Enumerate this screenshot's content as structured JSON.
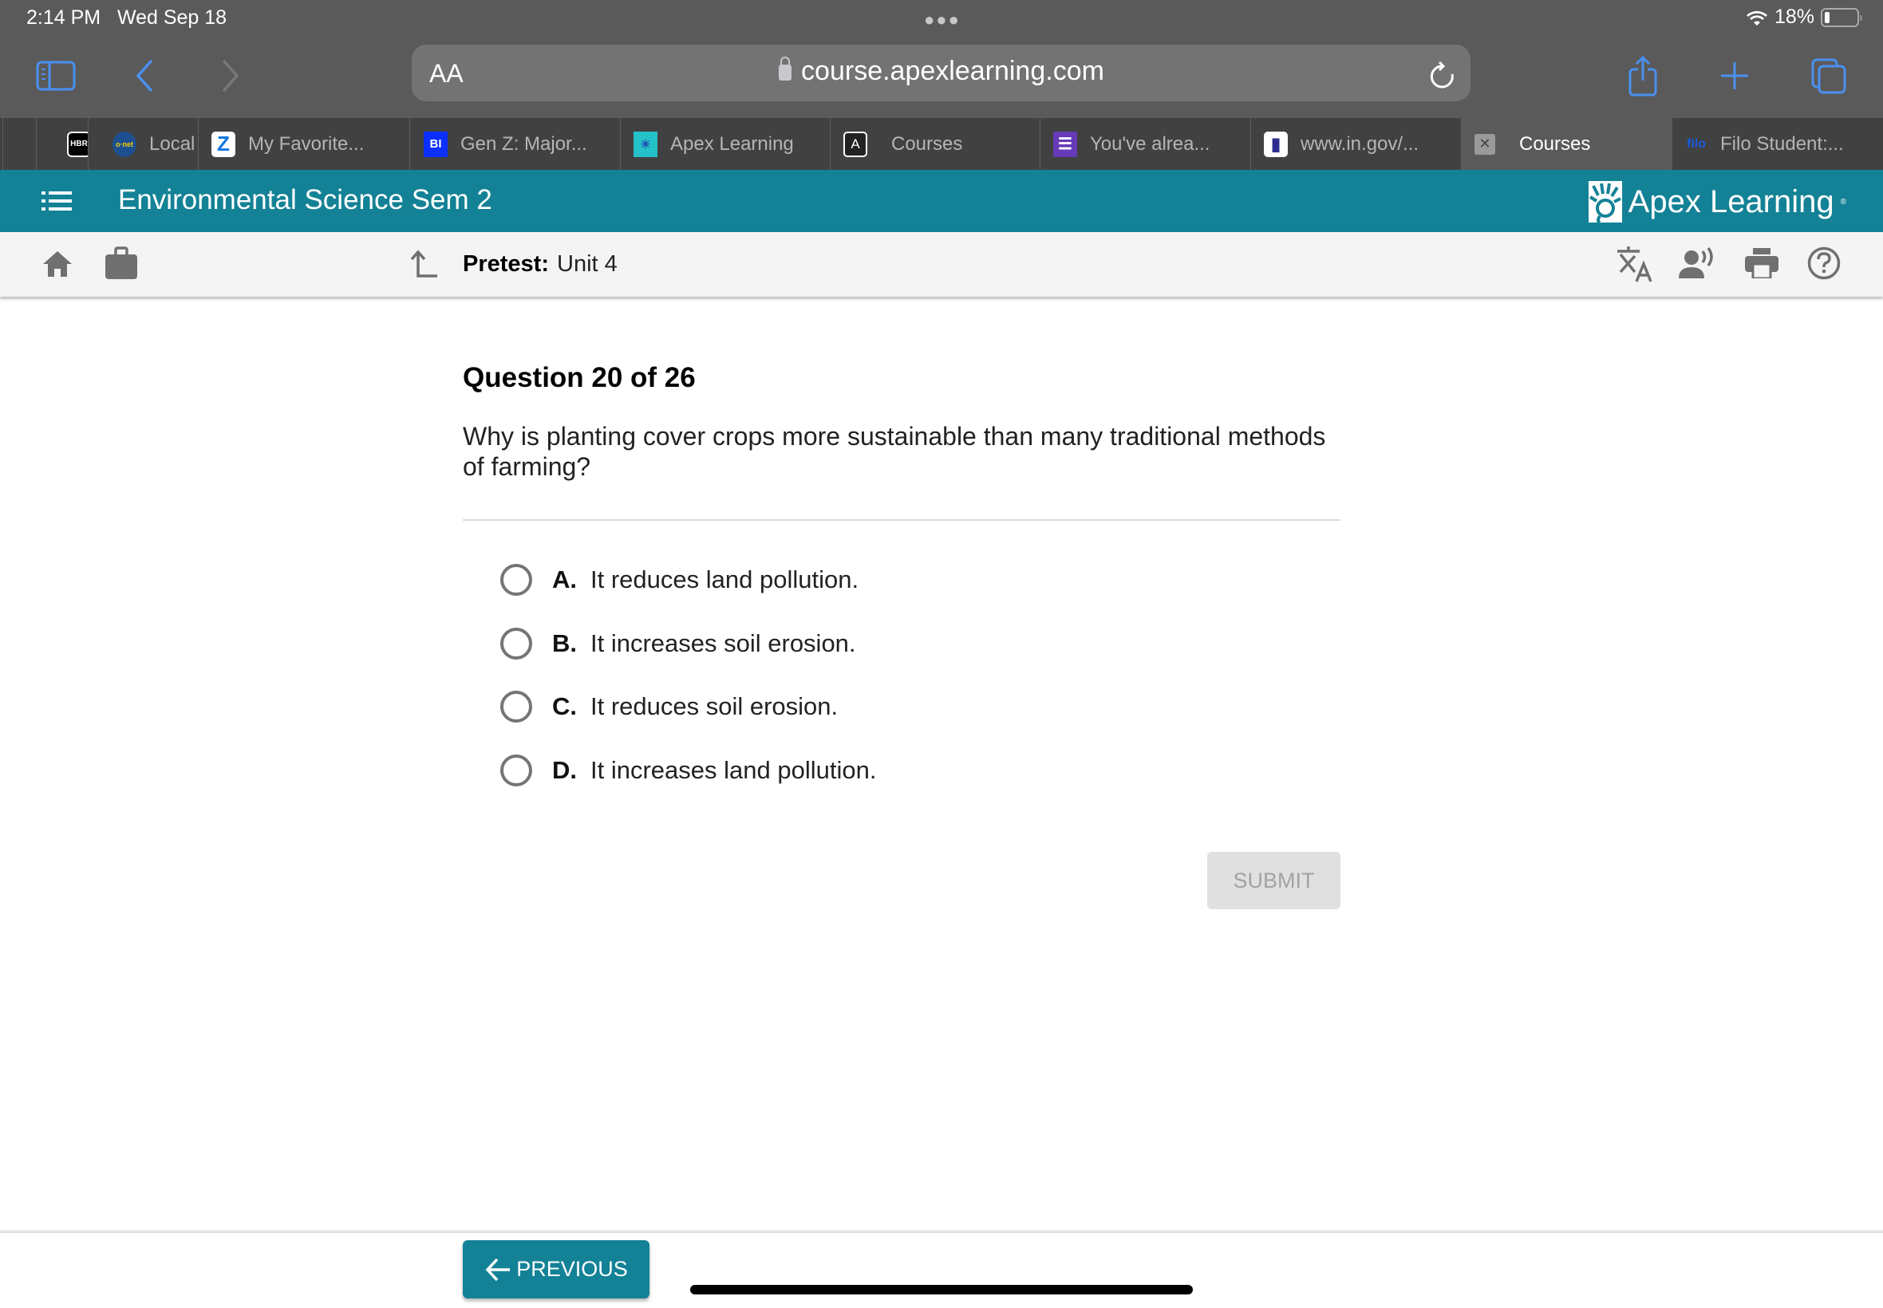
{
  "status_bar": {
    "time": "2:14 PM",
    "date": "Wed Sep 18",
    "battery_percent": "18%"
  },
  "browser": {
    "text_size_label": "AA",
    "url": "course.apexlearning.com",
    "tabs": [
      {
        "label": "",
        "favicon": "HBR",
        "active": false
      },
      {
        "label": "Local",
        "favicon": "onet",
        "active": false
      },
      {
        "label": "My Favorite...",
        "favicon": "zillow",
        "active": false
      },
      {
        "label": "Gen Z: Major...",
        "favicon": "BI",
        "active": false
      },
      {
        "label": "Apex Learning",
        "favicon": "apex",
        "active": false
      },
      {
        "label": "Courses",
        "favicon": "A",
        "active": false
      },
      {
        "label": "You've alrea...",
        "favicon": "forms",
        "active": false
      },
      {
        "label": "www.in.gov/...",
        "favicon": "indiana",
        "active": false
      },
      {
        "label": "Courses",
        "favicon": "close",
        "active": true
      },
      {
        "label": "Filo Student:...",
        "favicon": "filo",
        "active": false
      }
    ]
  },
  "header": {
    "course_title": "Environmental Science Sem 2",
    "brand": "Apex Learning",
    "brand_color": "#148296"
  },
  "subbar": {
    "activity_type": "Pretest:",
    "activity_name": "Unit 4"
  },
  "question": {
    "number_label": "Question 20 of 26",
    "text": "Why is planting cover crops more sustainable than many traditional methods of farming?",
    "options": [
      {
        "letter": "A.",
        "text": "It reduces land pollution.",
        "selected": false
      },
      {
        "letter": "B.",
        "text": "It increases soil erosion.",
        "selected": false
      },
      {
        "letter": "C.",
        "text": "It reduces soil erosion.",
        "selected": false
      },
      {
        "letter": "D.",
        "text": "It increases land pollution.",
        "selected": false
      }
    ],
    "submit_label": "SUBMIT"
  },
  "footer": {
    "previous_label": "PREVIOUS"
  }
}
